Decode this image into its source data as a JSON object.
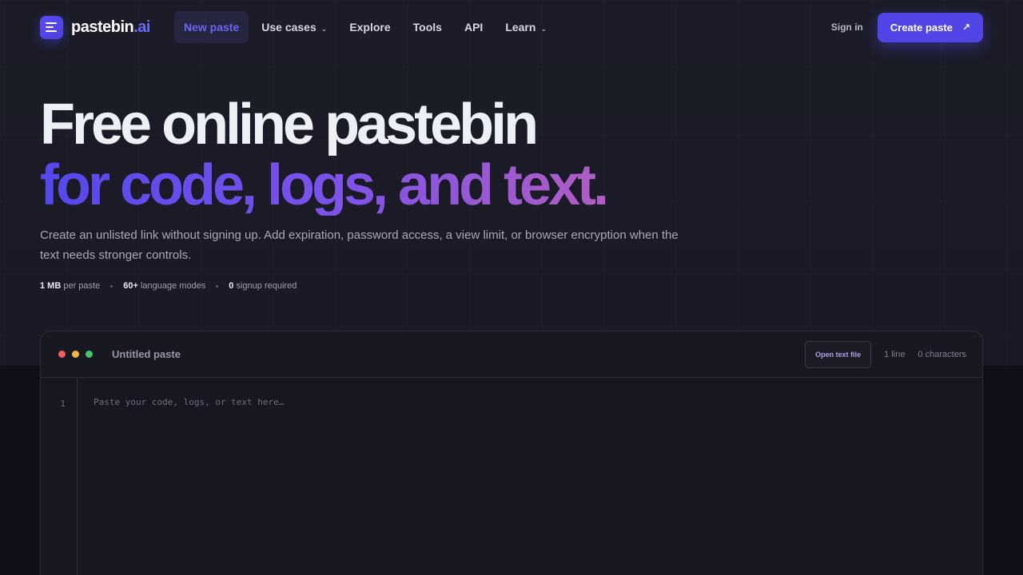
{
  "logo": {
    "name": "pastebin",
    "suffix": ".ai"
  },
  "nav": {
    "items": [
      {
        "label": "New paste",
        "active": true
      },
      {
        "label": "Use cases",
        "dropdown": true
      },
      {
        "label": "Explore"
      },
      {
        "label": "Tools"
      },
      {
        "label": "API"
      },
      {
        "label": "Learn",
        "dropdown": true
      }
    ],
    "sign_in": "Sign in",
    "create": "Create paste"
  },
  "hero": {
    "line1": "Free online pastebin",
    "line2": "for code, logs, and text.",
    "subtitle": "Create an unlisted link without signing up. Add expiration, password access, a view limit, or browser encryption when the text needs stronger controls.",
    "stats": [
      {
        "value": "1 MB",
        "label": "per paste"
      },
      {
        "value": "60+",
        "label": "language modes"
      },
      {
        "value": "0",
        "label": "signup required"
      }
    ]
  },
  "editor": {
    "title": "Untitled paste",
    "open_file": "Open text file",
    "lines": "1 line",
    "chars": "0 characters",
    "line_number": "1",
    "placeholder": "Paste your code, logs, or text here…",
    "dot_colors": [
      "#f0605e",
      "#f3b541",
      "#46c46a"
    ]
  },
  "colors": {
    "accent": "#5145e8"
  }
}
